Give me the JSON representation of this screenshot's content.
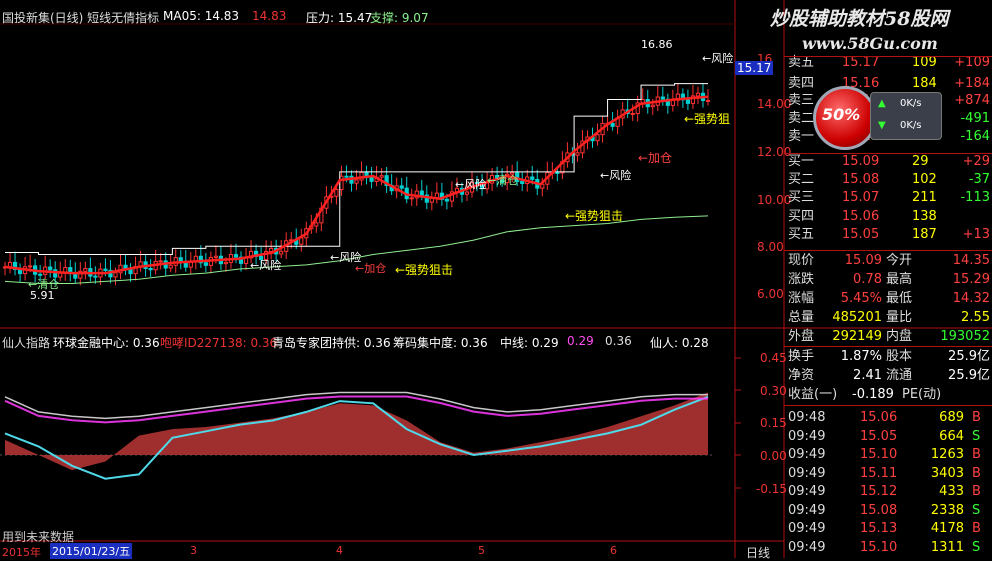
{
  "top_header": {
    "title": "国投新集(日线) 短线无倩指标",
    "ma5_label": "MA05: 14.83",
    "ma5_value": "14.83",
    "pressure_label": "压力: 15.47",
    "support_label": "支撑: 9.07"
  },
  "lower_header": {
    "title": "仙人指路",
    "items": [
      "环球金融中心: 0.36",
      "咆哮ID227138: 0.36",
      "青岛专家团持供: 0.36",
      "筹码集中度: 0.36",
      "中线: 0.29",
      "0.29",
      "0.36",
      "仙人: 0.28"
    ]
  },
  "watermark": {
    "line1": "炒股辅助教材58股网",
    "line2": "www.58Gu.com",
    "badge": "50%",
    "rate1": "0K/s",
    "rate2": "0K/s"
  },
  "annotations": {
    "fengxian": "←风险",
    "qingcang": "←清仓",
    "jiacang": "←加仓",
    "jiacang2": "←加仓",
    "qiangshi": "←强势狙击",
    "qiangshi2": "←强势狙击",
    "qiangshi3": "←强势狙",
    "fengxian2": "←风险",
    "fengxian3": "←风险",
    "fengxian4": "←风险",
    "fengxian5": "←风险",
    "qingcang2": "←清仓",
    "high_value": "16.86",
    "low_value": "5.91",
    "price_tag": "15.17"
  },
  "upper_axis_ticks": [
    "16",
    "14.00",
    "12.00",
    "10.00",
    "8.00",
    "6.00"
  ],
  "lower_axis_ticks": [
    "0.45",
    "0.30",
    "0.15",
    "0.00",
    "-0.15"
  ],
  "x_axis": {
    "labels": [
      "2015年",
      "2015/01/23/五",
      "3",
      "4",
      "5",
      "6"
    ],
    "right_label": "日线",
    "no_future": "用到未来数据"
  },
  "quote": {
    "asks": [
      {
        "label": "卖五",
        "price": "15.17",
        "vol": "109",
        "chg": "+109"
      },
      {
        "label": "卖四",
        "price": "15.16",
        "vol": "184",
        "chg": "+184"
      },
      {
        "label": "卖三",
        "price": "15.15",
        "vol": "874",
        "chg": "+874"
      },
      {
        "label": "卖二",
        "price": "15.13",
        "vol": "40",
        "chg": "-491"
      },
      {
        "label": "卖一",
        "price": "15.10",
        "vol": "100",
        "chg": "-164"
      }
    ],
    "bids": [
      {
        "label": "买一",
        "price": "15.09",
        "vol": "29",
        "chg": "+29"
      },
      {
        "label": "买二",
        "price": "15.08",
        "vol": "102",
        "chg": "-37"
      },
      {
        "label": "买三",
        "price": "15.07",
        "vol": "211",
        "chg": "-113"
      },
      {
        "label": "买四",
        "price": "15.06",
        "vol": "138",
        "chg": ""
      },
      {
        "label": "买五",
        "price": "15.05",
        "vol": "187",
        "chg": "+13"
      }
    ],
    "stats": [
      {
        "l1": "现价",
        "v1": "15.09",
        "l2": "今开",
        "v2": "14.35"
      },
      {
        "l1": "涨跌",
        "v1": "0.78",
        "l2": "最高",
        "v2": "15.29"
      },
      {
        "l1": "涨幅",
        "v1": "5.45%",
        "l2": "最低",
        "v2": "14.32"
      },
      {
        "l1": "总量",
        "v1": "485201",
        "l2": "量比",
        "v2": "2.55"
      },
      {
        "l1": "外盘",
        "v1": "292149",
        "l2": "内盘",
        "v2": "193052"
      }
    ],
    "stats2": [
      {
        "l1": "换手",
        "v1": "1.87%",
        "l2": "股本",
        "v2": "25.9亿"
      },
      {
        "l1": "净资",
        "v1": "2.41",
        "l2": "流通",
        "v2": "25.9亿"
      }
    ],
    "eps": {
      "label": "收益(一)",
      "value": "-0.189",
      "tail": "PE(动)"
    },
    "ticks": [
      {
        "t": "09:48",
        "p": "15.06",
        "v": "689",
        "d": "B"
      },
      {
        "t": "09:49",
        "p": "15.05",
        "v": "664",
        "d": "S"
      },
      {
        "t": "09:49",
        "p": "15.10",
        "v": "1263",
        "d": "B"
      },
      {
        "t": "09:49",
        "p": "15.11",
        "v": "3403",
        "d": "B"
      },
      {
        "t": "09:49",
        "p": "15.12",
        "v": "433",
        "d": "B"
      },
      {
        "t": "09:49",
        "p": "15.08",
        "v": "2338",
        "d": "S"
      },
      {
        "t": "09:49",
        "p": "15.13",
        "v": "4178",
        "d": "B"
      },
      {
        "t": "09:49",
        "p": "15.10",
        "v": "1311",
        "d": "S"
      }
    ]
  },
  "chart_data": [
    {
      "type": "line",
      "title": "国投新集(日线) 短线无倩指标",
      "x": [
        0,
        10,
        20,
        30,
        40,
        50,
        60,
        70,
        80,
        90,
        100,
        110,
        120,
        130,
        140,
        150,
        160,
        170,
        180,
        190,
        200,
        210
      ],
      "series": [
        {
          "name": "MA05",
          "values": [
            6.6,
            6.4,
            6.3,
            6.3,
            6.6,
            6.8,
            6.9,
            7.0,
            7.3,
            8.2,
            10.8,
            11.0,
            10.1,
            9.9,
            10.5,
            11.0,
            10.6,
            12.2,
            13.5,
            14.5,
            14.7,
            14.83
          ]
        },
        {
          "name": "压力",
          "values": [
            7.3,
            7.2,
            7.2,
            7.2,
            7.2,
            7.5,
            7.6,
            7.6,
            7.6,
            7.6,
            11.2,
            11.2,
            11.2,
            11.2,
            11.2,
            11.2,
            11.2,
            13.9,
            14.7,
            15.4,
            15.47,
            15.47
          ]
        },
        {
          "name": "支撑",
          "values": [
            5.9,
            5.8,
            5.8,
            5.9,
            6.0,
            6.2,
            6.3,
            6.5,
            6.6,
            6.7,
            6.9,
            7.2,
            7.4,
            7.6,
            7.9,
            8.3,
            8.5,
            8.6,
            8.7,
            8.9,
            9.0,
            9.07
          ]
        }
      ],
      "ylim": [
        5.0,
        17.0
      ]
    },
    {
      "type": "line",
      "title": "仙人指路",
      "x": [
        0,
        10,
        20,
        30,
        40,
        50,
        60,
        70,
        80,
        90,
        100,
        110,
        120,
        130,
        140,
        150,
        160,
        170,
        180,
        190,
        200,
        210
      ],
      "series": [
        {
          "name": "中线",
          "values": [
            0.1,
            0.04,
            -0.05,
            -0.11,
            -0.09,
            0.08,
            0.11,
            0.14,
            0.16,
            0.2,
            0.25,
            0.24,
            0.12,
            0.05,
            -0.0,
            0.02,
            0.04,
            0.07,
            0.1,
            0.14,
            0.21,
            0.27
          ]
        },
        {
          "name": "仙人",
          "values": [
            0.27,
            0.2,
            0.18,
            0.17,
            0.18,
            0.2,
            0.22,
            0.24,
            0.26,
            0.28,
            0.29,
            0.29,
            0.29,
            0.26,
            0.22,
            0.2,
            0.21,
            0.23,
            0.25,
            0.27,
            0.28,
            0.28
          ]
        },
        {
          "name": "筹码集中度",
          "values": [
            0.07,
            0.0,
            -0.07,
            -0.03,
            0.09,
            0.12,
            0.13,
            0.15,
            0.17,
            0.2,
            0.24,
            0.23,
            0.16,
            0.06,
            0.01,
            0.03,
            0.06,
            0.09,
            0.13,
            0.18,
            0.23,
            0.29
          ]
        }
      ],
      "ylim": [
        -0.2,
        0.5
      ]
    }
  ]
}
